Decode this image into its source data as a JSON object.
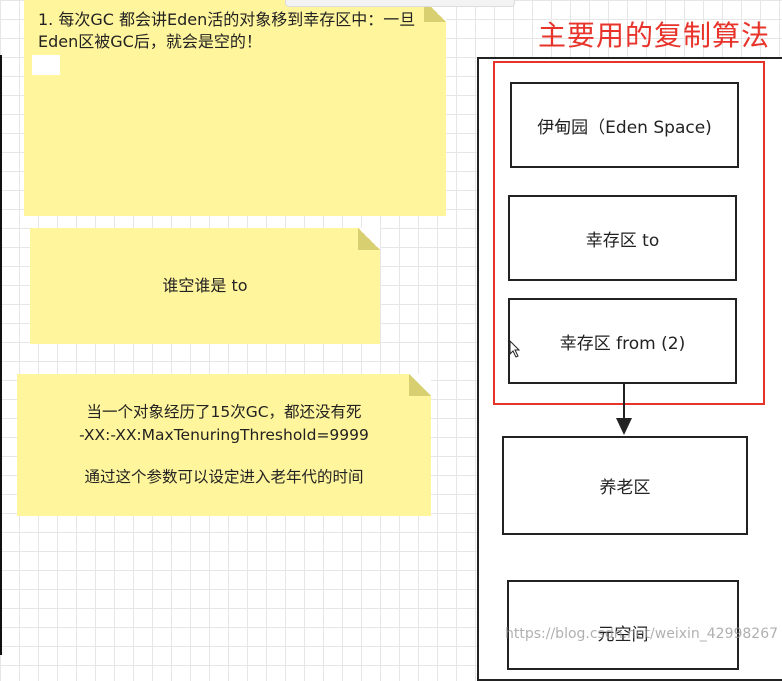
{
  "notes": {
    "note1": "1. 每次GC 都会讲Eden活的对象移到幸存区中：一旦Eden区被GC后，就会是空的！",
    "note2": "谁空谁是 to",
    "note3_line1": "当一个对象经历了15次GC，都还没有死",
    "note3_line2": "-XX:-XX:MaxTenuringThreshold=9999",
    "note3_line3": "通过这个参数可以设定进入老年代的时间"
  },
  "diagram": {
    "annotation": "主要用的复制算法",
    "eden": "伊甸园（Eden Space)",
    "survivor_to": "幸存区  to",
    "survivor_from": "幸存区  from  (2)",
    "old_gen": "养老区",
    "metaspace": "元空间"
  },
  "watermark": "https://blog.csdn.net/weixin_42998267",
  "colors": {
    "note_yellow": "#fff59c",
    "highlight_red": "#e8332a",
    "border": "#222222"
  }
}
